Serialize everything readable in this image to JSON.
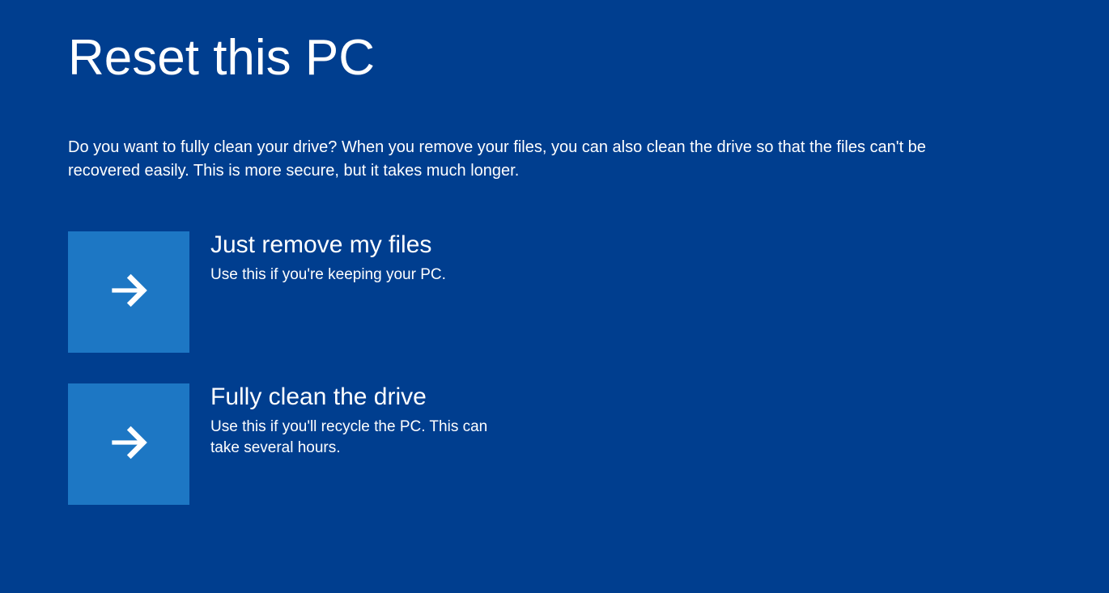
{
  "title": "Reset this PC",
  "subtitle": "Do you want to fully clean your drive? When you remove your files, you can also clean the drive so that the files can't be recovered easily. This is more secure, but it takes much longer.",
  "options": [
    {
      "title": "Just remove my files",
      "description": "Use this if you're keeping your PC.",
      "icon": "arrow-right"
    },
    {
      "title": "Fully clean the drive",
      "description": "Use this if you'll recycle the PC. This can take several hours.",
      "icon": "arrow-right"
    }
  ],
  "colors": {
    "background": "#003e8f",
    "tile": "#1d77c4",
    "text": "#ffffff"
  }
}
